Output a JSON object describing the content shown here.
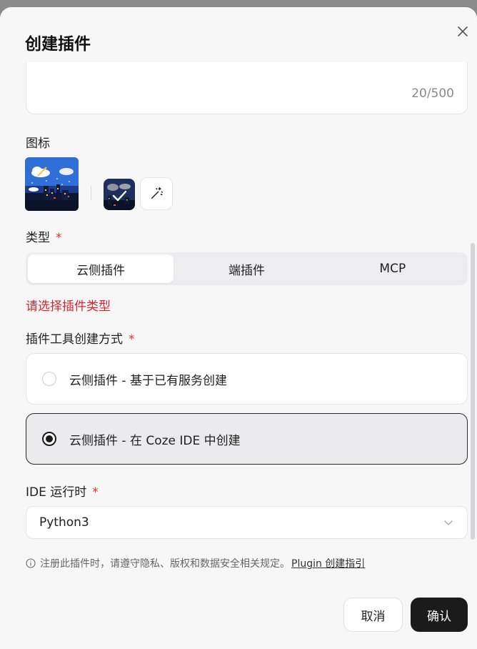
{
  "dialog": {
    "title": "创建插件"
  },
  "description": {
    "counter": "20/500"
  },
  "icon_section": {
    "label": "图标",
    "main_icon": "city-night-weather-icon",
    "small_icon": "city-night-check-icon",
    "wand_icon": "magic-wand-icon"
  },
  "type_section": {
    "label": "类型",
    "required_mark": "*",
    "tabs": [
      "云侧插件",
      "端插件",
      "MCP"
    ],
    "active_tab": 0,
    "error": "请选择插件类型"
  },
  "method_section": {
    "label": "插件工具创建方式",
    "required_mark": "*",
    "options": [
      {
        "label": "云侧插件 - 基于已有服务创建",
        "selected": false
      },
      {
        "label": "云侧插件 - 在 Coze IDE 中创建",
        "selected": true
      }
    ]
  },
  "runtime_section": {
    "label": "IDE 运行时",
    "required_mark": "*",
    "selected": "Python3"
  },
  "notice": {
    "text": "注册此插件时，请遵守隐私、版权和数据安全相关规定。",
    "link": "Plugin 创建指引"
  },
  "footer": {
    "cancel_label": "取消",
    "confirm_label": "确认"
  },
  "colors": {
    "required": "#e0313b",
    "error": "#d9242d",
    "primary_button": "#1b1b1b"
  }
}
